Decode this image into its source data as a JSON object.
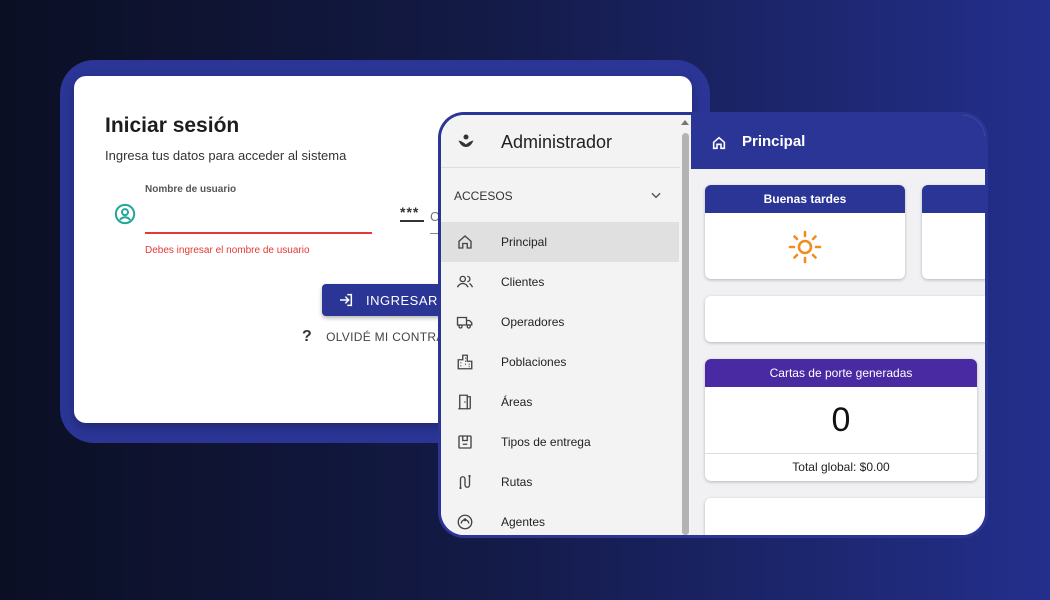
{
  "login": {
    "title": "Iniciar sesión",
    "subtitle": "Ingresa tus datos para acceder al sistema",
    "username_label": "Nombre de usuario",
    "username_value": "",
    "username_error": "Debes ingresar el nombre de usuario",
    "password_icon_text": "***",
    "password_partial": "C",
    "submit_label": "INGRESAR",
    "forgot_label": "OLVIDÉ MI CONTRA",
    "forgot_icon": "?"
  },
  "sidebar": {
    "brand_title": "Administrador",
    "section_label": "ACCESOS",
    "items": [
      {
        "label": "Principal",
        "icon": "home-icon",
        "active": true
      },
      {
        "label": "Clientes",
        "icon": "users-icon"
      },
      {
        "label": "Operadores",
        "icon": "truck-icon"
      },
      {
        "label": "Poblaciones",
        "icon": "city-icon"
      },
      {
        "label": "Áreas",
        "icon": "door-icon"
      },
      {
        "label": "Tipos de entrega",
        "icon": "package-icon"
      },
      {
        "label": "Rutas",
        "icon": "route-icon"
      },
      {
        "label": "Agentes",
        "icon": "agent-icon"
      }
    ]
  },
  "main": {
    "header_title": "Principal",
    "greeting_card_title": "Buenas tardes",
    "cartas_card_title": "Cartas de porte generadas",
    "cartas_count": "0",
    "cartas_total": "Total global: $0.00"
  },
  "colors": {
    "primary": "#2b3595",
    "purple_header": "#4a2aa3",
    "error": "#e53935",
    "user_icon": "#26a69a",
    "sun": "#f28c1c"
  }
}
